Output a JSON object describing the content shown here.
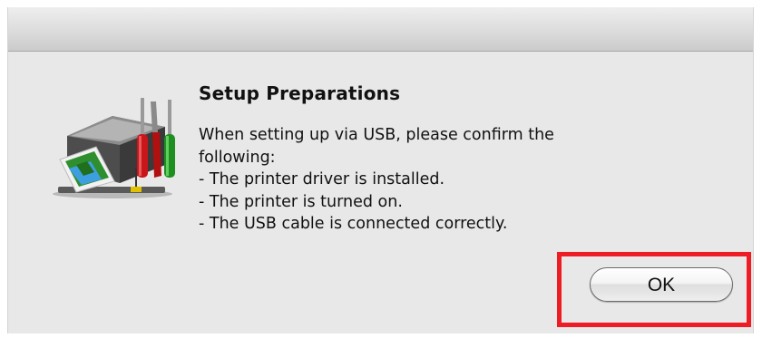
{
  "dialog": {
    "title": "Setup Preparations",
    "icon": "printer-tools-icon",
    "message_lines": [
      "When setting up via USB, please confirm the",
      "following:",
      "- The printer driver is installed.",
      "- The printer is turned on.",
      "- The USB cable is connected correctly."
    ],
    "ok_label": "OK"
  },
  "colors": {
    "dialog_background": "#e8e8e8",
    "highlight_border": "#ee1c24"
  }
}
